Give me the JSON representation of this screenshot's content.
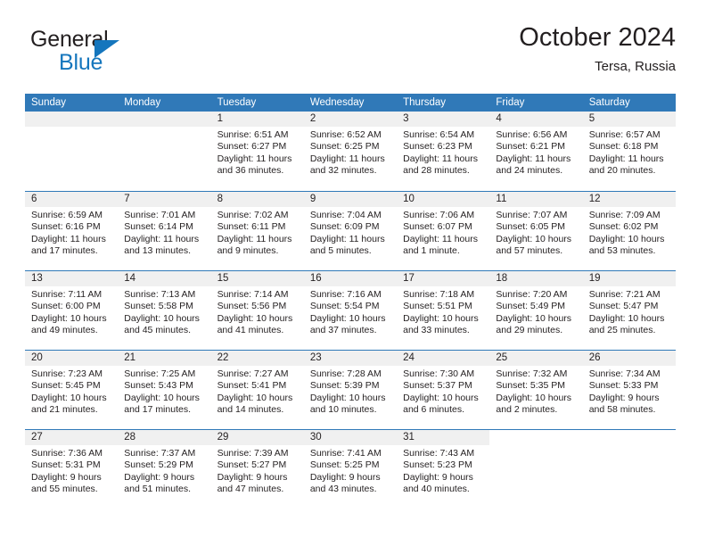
{
  "brand": {
    "name_part1": "General",
    "name_part2": "Blue",
    "flag_icon": "triangle-flag-icon",
    "accent_color": "#1576bd"
  },
  "header": {
    "title": "October 2024",
    "subtitle": "Tersa, Russia"
  },
  "theme": {
    "header_blue": "#3079b8",
    "day_band_gray": "#f0f0f0",
    "text": "#231f20"
  },
  "calendar": {
    "weekdays": [
      "Sunday",
      "Monday",
      "Tuesday",
      "Wednesday",
      "Thursday",
      "Friday",
      "Saturday"
    ],
    "labels": {
      "sunrise_prefix": "Sunrise:",
      "sunset_prefix": "Sunset:",
      "daylight_prefix": "Daylight:"
    },
    "weeks": [
      [
        {
          "day": "",
          "empty": true
        },
        {
          "day": "",
          "empty": true
        },
        {
          "day": "1",
          "sunrise": "Sunrise: 6:51 AM",
          "sunset": "Sunset: 6:27 PM",
          "daylight": "Daylight: 11 hours and 36 minutes."
        },
        {
          "day": "2",
          "sunrise": "Sunrise: 6:52 AM",
          "sunset": "Sunset: 6:25 PM",
          "daylight": "Daylight: 11 hours and 32 minutes."
        },
        {
          "day": "3",
          "sunrise": "Sunrise: 6:54 AM",
          "sunset": "Sunset: 6:23 PM",
          "daylight": "Daylight: 11 hours and 28 minutes."
        },
        {
          "day": "4",
          "sunrise": "Sunrise: 6:56 AM",
          "sunset": "Sunset: 6:21 PM",
          "daylight": "Daylight: 11 hours and 24 minutes."
        },
        {
          "day": "5",
          "sunrise": "Sunrise: 6:57 AM",
          "sunset": "Sunset: 6:18 PM",
          "daylight": "Daylight: 11 hours and 20 minutes."
        }
      ],
      [
        {
          "day": "6",
          "sunrise": "Sunrise: 6:59 AM",
          "sunset": "Sunset: 6:16 PM",
          "daylight": "Daylight: 11 hours and 17 minutes."
        },
        {
          "day": "7",
          "sunrise": "Sunrise: 7:01 AM",
          "sunset": "Sunset: 6:14 PM",
          "daylight": "Daylight: 11 hours and 13 minutes."
        },
        {
          "day": "8",
          "sunrise": "Sunrise: 7:02 AM",
          "sunset": "Sunset: 6:11 PM",
          "daylight": "Daylight: 11 hours and 9 minutes."
        },
        {
          "day": "9",
          "sunrise": "Sunrise: 7:04 AM",
          "sunset": "Sunset: 6:09 PM",
          "daylight": "Daylight: 11 hours and 5 minutes."
        },
        {
          "day": "10",
          "sunrise": "Sunrise: 7:06 AM",
          "sunset": "Sunset: 6:07 PM",
          "daylight": "Daylight: 11 hours and 1 minute."
        },
        {
          "day": "11",
          "sunrise": "Sunrise: 7:07 AM",
          "sunset": "Sunset: 6:05 PM",
          "daylight": "Daylight: 10 hours and 57 minutes."
        },
        {
          "day": "12",
          "sunrise": "Sunrise: 7:09 AM",
          "sunset": "Sunset: 6:02 PM",
          "daylight": "Daylight: 10 hours and 53 minutes."
        }
      ],
      [
        {
          "day": "13",
          "sunrise": "Sunrise: 7:11 AM",
          "sunset": "Sunset: 6:00 PM",
          "daylight": "Daylight: 10 hours and 49 minutes."
        },
        {
          "day": "14",
          "sunrise": "Sunrise: 7:13 AM",
          "sunset": "Sunset: 5:58 PM",
          "daylight": "Daylight: 10 hours and 45 minutes."
        },
        {
          "day": "15",
          "sunrise": "Sunrise: 7:14 AM",
          "sunset": "Sunset: 5:56 PM",
          "daylight": "Daylight: 10 hours and 41 minutes."
        },
        {
          "day": "16",
          "sunrise": "Sunrise: 7:16 AM",
          "sunset": "Sunset: 5:54 PM",
          "daylight": "Daylight: 10 hours and 37 minutes."
        },
        {
          "day": "17",
          "sunrise": "Sunrise: 7:18 AM",
          "sunset": "Sunset: 5:51 PM",
          "daylight": "Daylight: 10 hours and 33 minutes."
        },
        {
          "day": "18",
          "sunrise": "Sunrise: 7:20 AM",
          "sunset": "Sunset: 5:49 PM",
          "daylight": "Daylight: 10 hours and 29 minutes."
        },
        {
          "day": "19",
          "sunrise": "Sunrise: 7:21 AM",
          "sunset": "Sunset: 5:47 PM",
          "daylight": "Daylight: 10 hours and 25 minutes."
        }
      ],
      [
        {
          "day": "20",
          "sunrise": "Sunrise: 7:23 AM",
          "sunset": "Sunset: 5:45 PM",
          "daylight": "Daylight: 10 hours and 21 minutes."
        },
        {
          "day": "21",
          "sunrise": "Sunrise: 7:25 AM",
          "sunset": "Sunset: 5:43 PM",
          "daylight": "Daylight: 10 hours and 17 minutes."
        },
        {
          "day": "22",
          "sunrise": "Sunrise: 7:27 AM",
          "sunset": "Sunset: 5:41 PM",
          "daylight": "Daylight: 10 hours and 14 minutes."
        },
        {
          "day": "23",
          "sunrise": "Sunrise: 7:28 AM",
          "sunset": "Sunset: 5:39 PM",
          "daylight": "Daylight: 10 hours and 10 minutes."
        },
        {
          "day": "24",
          "sunrise": "Sunrise: 7:30 AM",
          "sunset": "Sunset: 5:37 PM",
          "daylight": "Daylight: 10 hours and 6 minutes."
        },
        {
          "day": "25",
          "sunrise": "Sunrise: 7:32 AM",
          "sunset": "Sunset: 5:35 PM",
          "daylight": "Daylight: 10 hours and 2 minutes."
        },
        {
          "day": "26",
          "sunrise": "Sunrise: 7:34 AM",
          "sunset": "Sunset: 5:33 PM",
          "daylight": "Daylight: 9 hours and 58 minutes."
        }
      ],
      [
        {
          "day": "27",
          "sunrise": "Sunrise: 7:36 AM",
          "sunset": "Sunset: 5:31 PM",
          "daylight": "Daylight: 9 hours and 55 minutes."
        },
        {
          "day": "28",
          "sunrise": "Sunrise: 7:37 AM",
          "sunset": "Sunset: 5:29 PM",
          "daylight": "Daylight: 9 hours and 51 minutes."
        },
        {
          "day": "29",
          "sunrise": "Sunrise: 7:39 AM",
          "sunset": "Sunset: 5:27 PM",
          "daylight": "Daylight: 9 hours and 47 minutes."
        },
        {
          "day": "30",
          "sunrise": "Sunrise: 7:41 AM",
          "sunset": "Sunset: 5:25 PM",
          "daylight": "Daylight: 9 hours and 43 minutes."
        },
        {
          "day": "31",
          "sunrise": "Sunrise: 7:43 AM",
          "sunset": "Sunset: 5:23 PM",
          "daylight": "Daylight: 9 hours and 40 minutes."
        },
        {
          "day": "",
          "empty": true,
          "tail": true
        },
        {
          "day": "",
          "empty": true,
          "tail": true
        }
      ]
    ]
  }
}
